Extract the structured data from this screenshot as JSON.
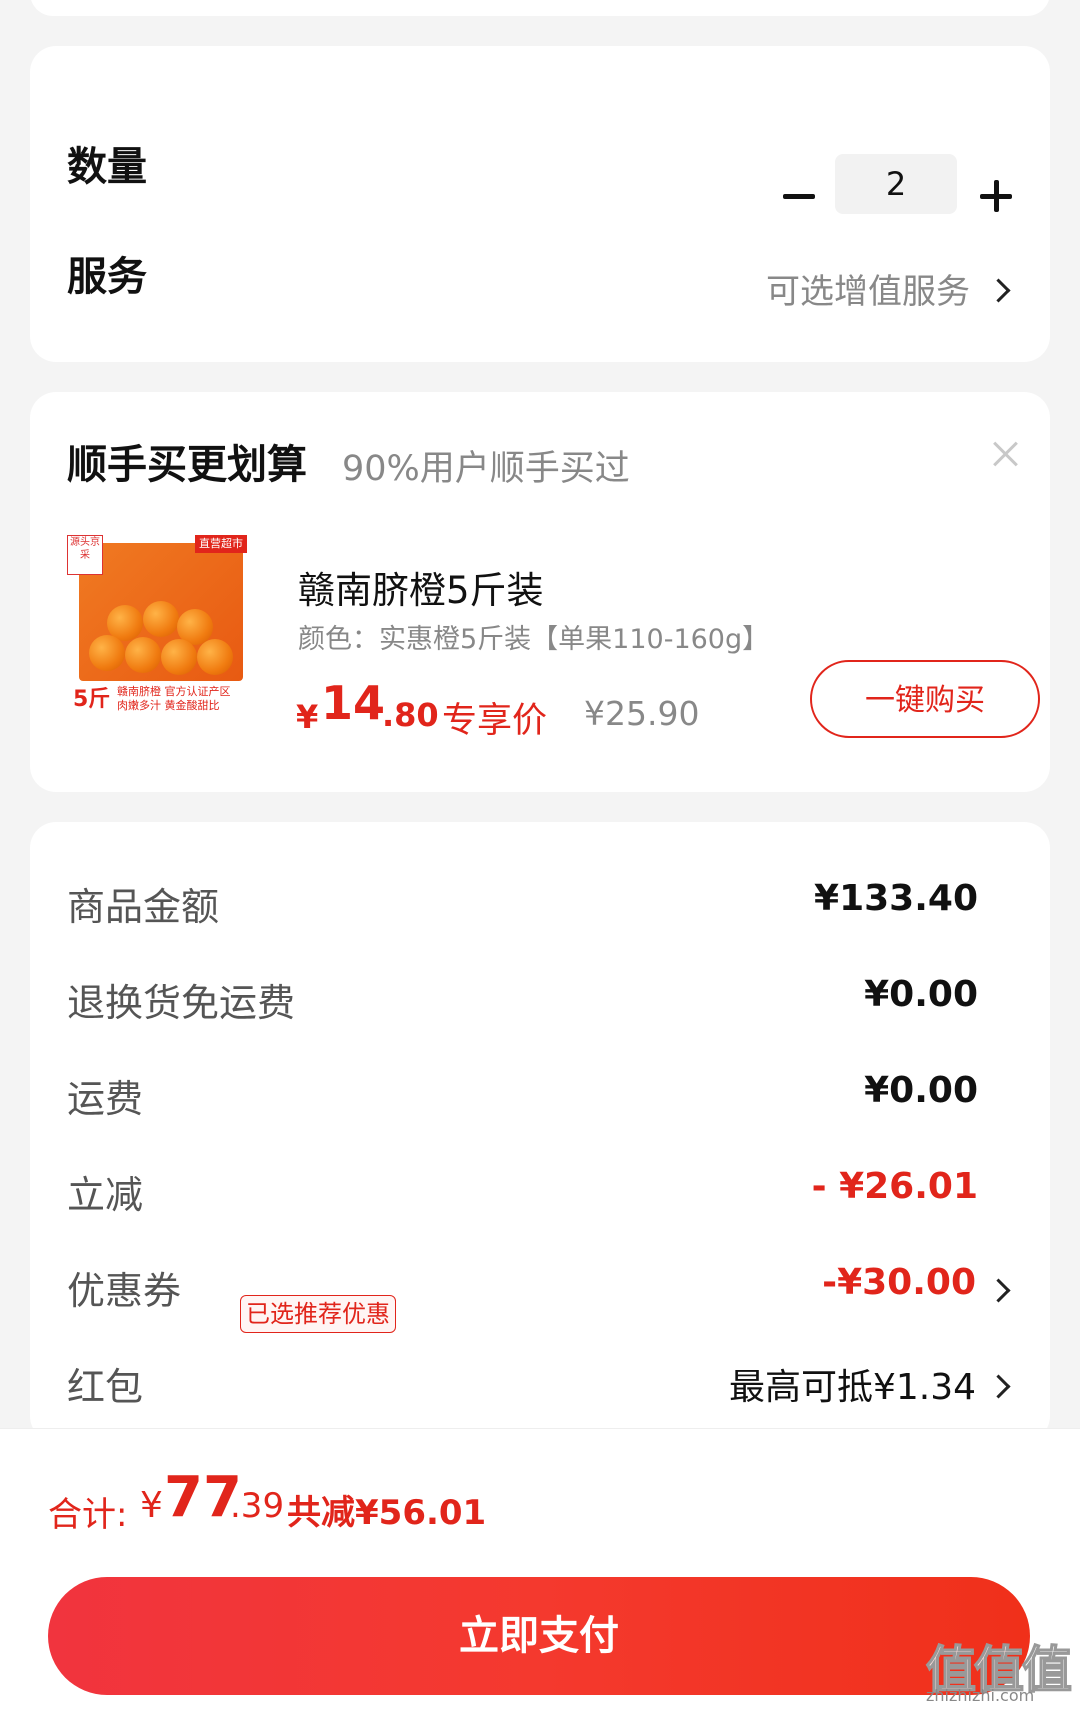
{
  "options": {
    "quantity_label": "数量",
    "quantity_value": "2",
    "service_label": "服务",
    "service_value": "可选增值服务"
  },
  "addon": {
    "title": "顺手买更划算",
    "subtitle": "90%用户顺手买过",
    "thumbnail": {
      "tag": "源头京采",
      "brand": "直营超市",
      "weight": "5斤",
      "caption_line1": "赣南脐橙 官方认证产区",
      "caption_line2": "肉嫩多汁 黄金酸甜比"
    },
    "product_name": "赣南脐橙5斤装",
    "product_spec": "颜色：实惠橙5斤装【单果110-160g】",
    "price_symbol": "¥",
    "price_int": "14",
    "price_dec": ".80",
    "price_tag": "专享价",
    "original_price": "¥25.90",
    "buy_label": "一键购买"
  },
  "summary": {
    "rows": [
      {
        "label": "商品金额",
        "value": "¥133.40"
      },
      {
        "label": "退换货免运费",
        "value": "¥0.00"
      },
      {
        "label": "运费",
        "value": "¥0.00"
      },
      {
        "label": "立减",
        "value": "- ¥26.01"
      },
      {
        "label": "优惠券",
        "badge": "已选推荐优惠",
        "value": "-¥30.00"
      },
      {
        "label": "红包",
        "value": "最高可抵¥1.34"
      }
    ]
  },
  "footer": {
    "total_label": "合计:",
    "total_symbol": "¥",
    "total_int": "77",
    "total_dec": ".39",
    "total_saved": "共减¥56.01",
    "pay_label": "立即支付"
  },
  "watermark": {
    "big": "值值值",
    "small": "zhizhizhi.com"
  },
  "colors": {
    "accent": "#e1251b",
    "background": "#f4f4f4",
    "pay_button": "#f4392e"
  }
}
